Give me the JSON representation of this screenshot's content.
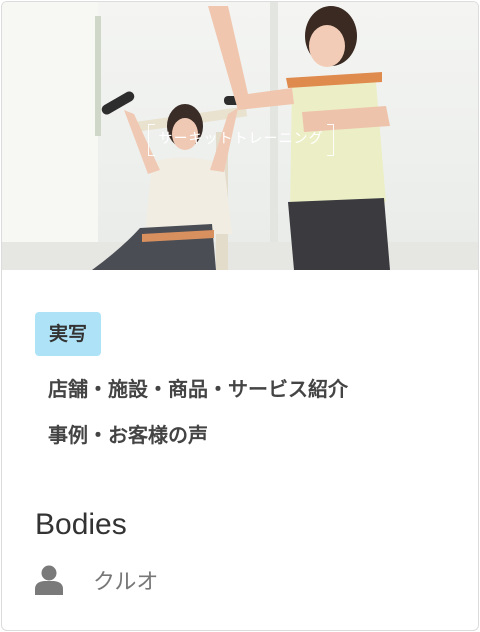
{
  "card": {
    "thumbnail": {
      "overlay_title": "サーキットトレーニング"
    },
    "badge": "実写",
    "categories": [
      "店舗・施設・商品・サービス紹介",
      "事例・お客様の声"
    ],
    "title": "Bodies",
    "author": {
      "icon": "user-icon",
      "name": "クルオ"
    }
  }
}
